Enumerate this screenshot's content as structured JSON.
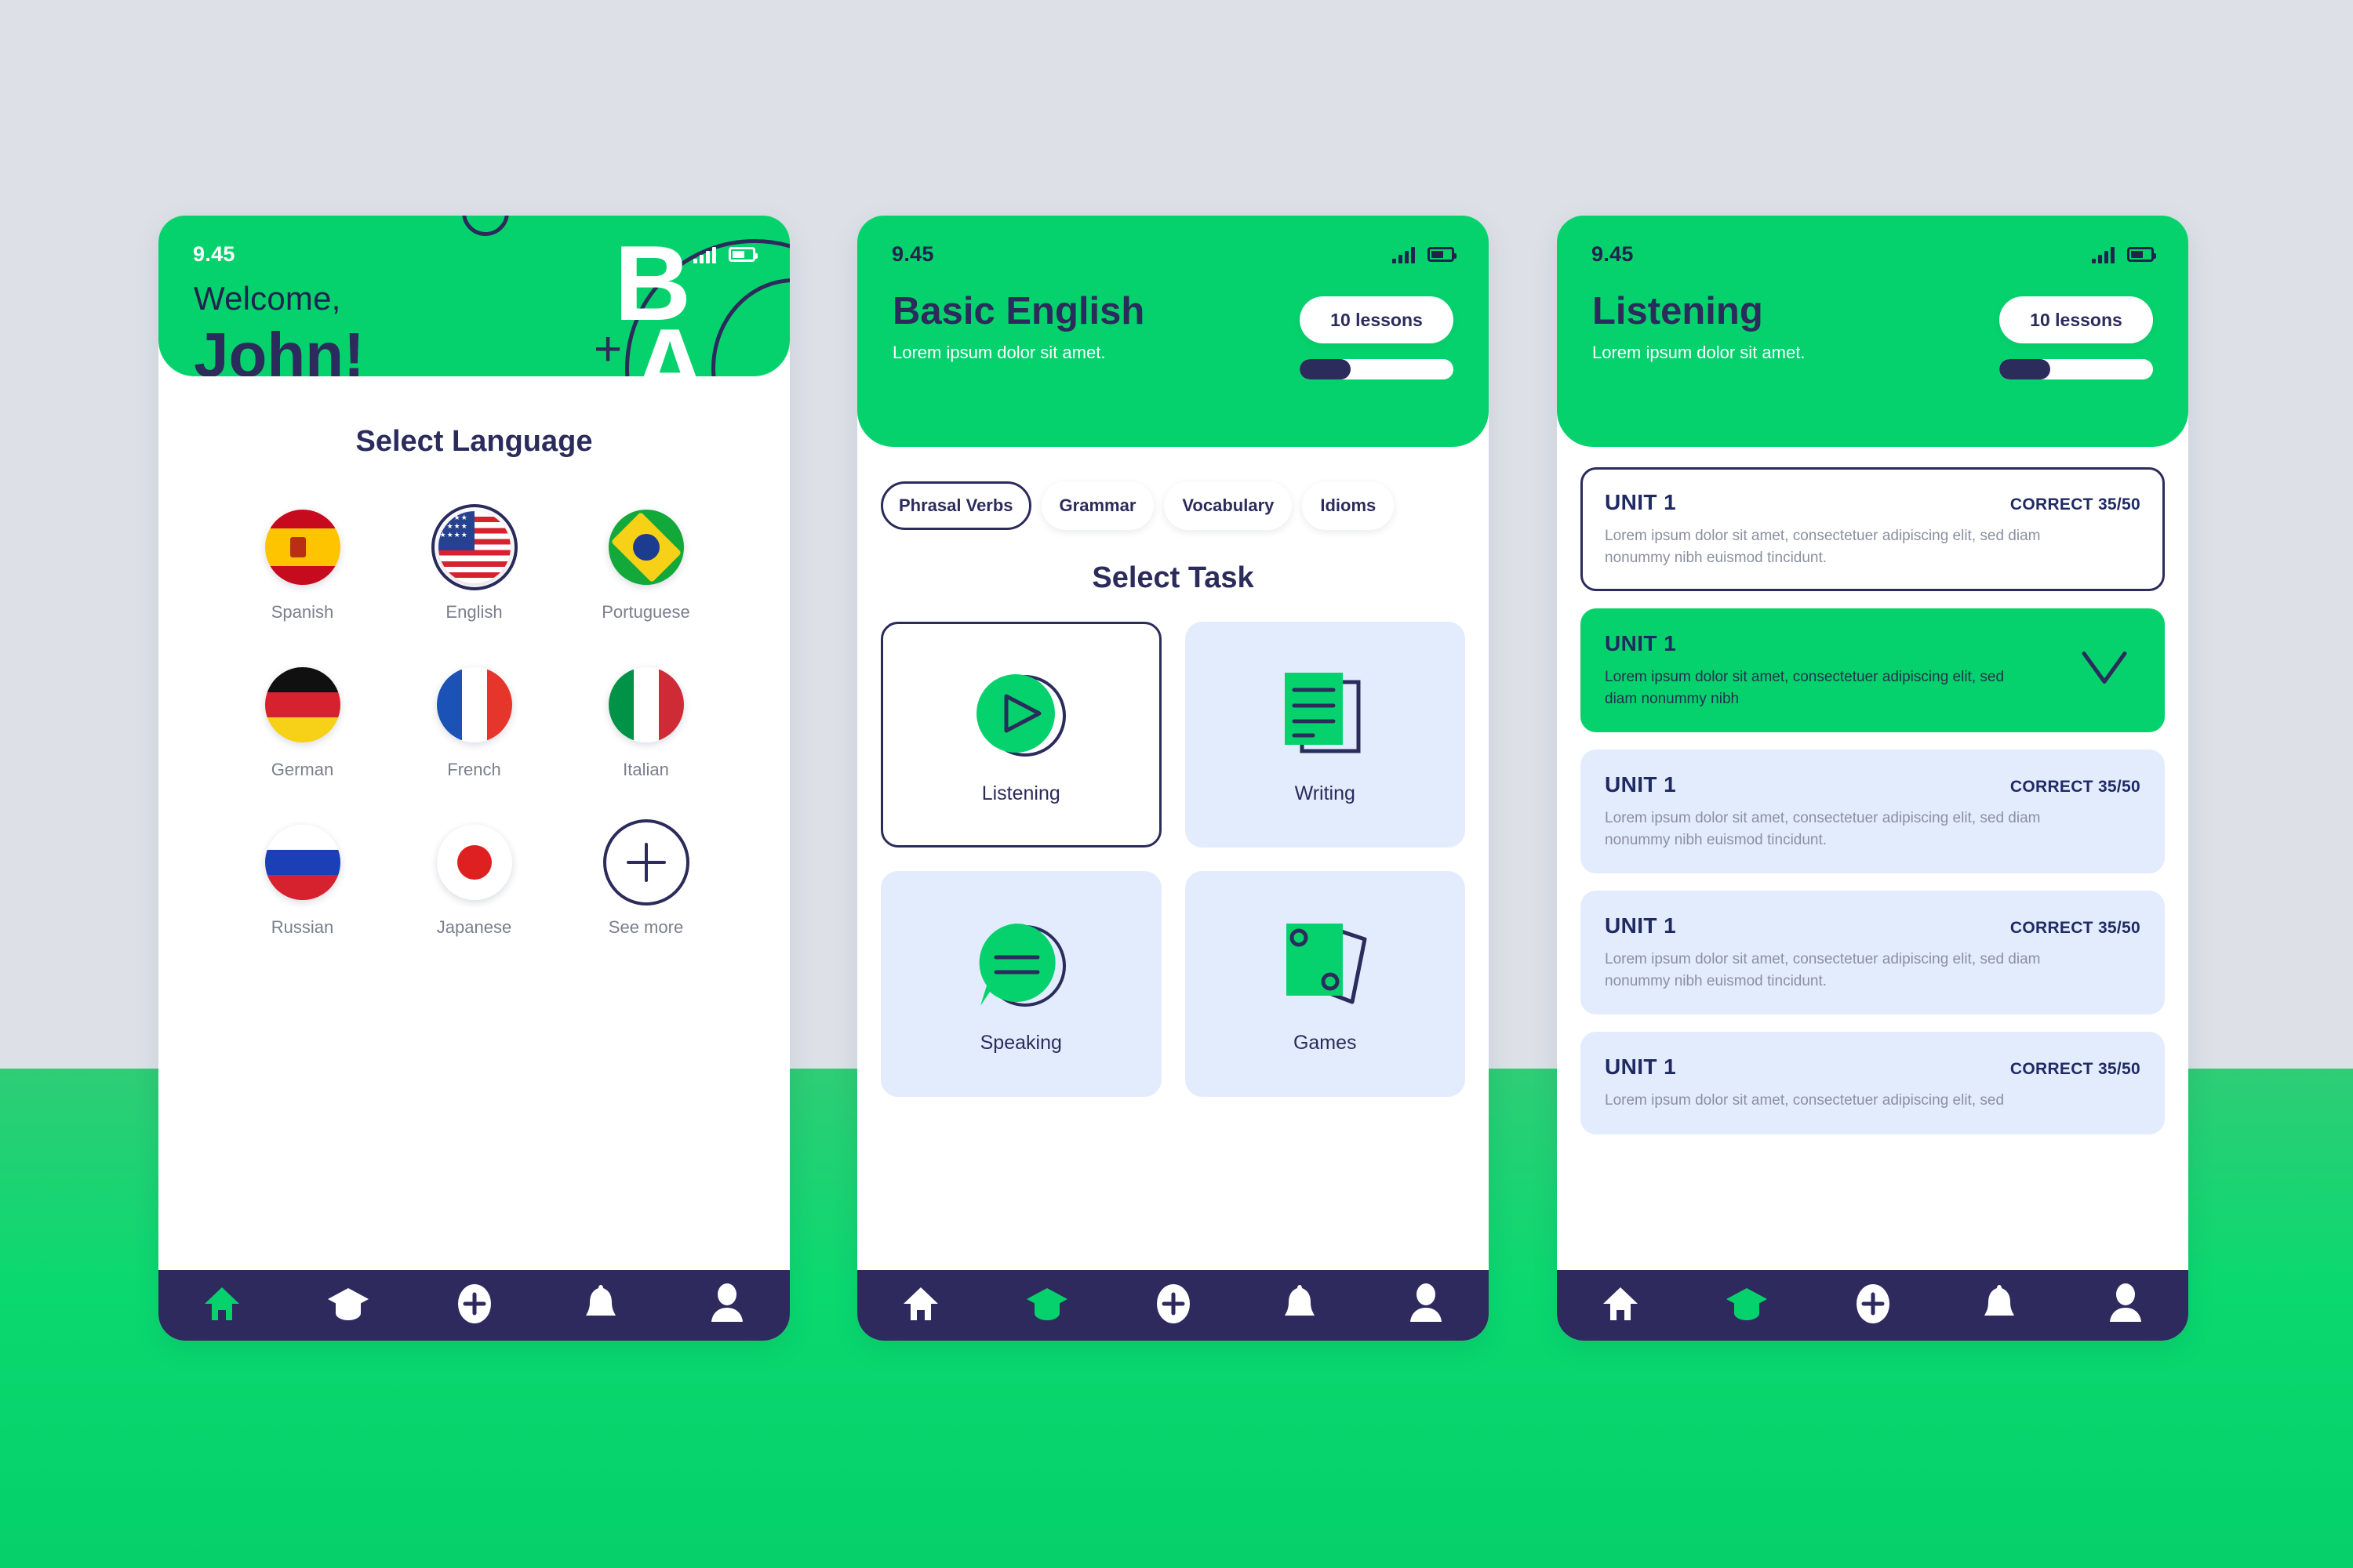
{
  "theme": {
    "green": "#06d26d",
    "navy": "#2b2b5c",
    "light_blue": "#e3ecfd",
    "bg_top": "#dde1e7"
  },
  "screen1": {
    "status": {
      "time": "9.45",
      "signal_icon": "signal-bars-icon",
      "battery_icon": "battery-icon"
    },
    "logo": {
      "letter_b": "B",
      "plus": "+",
      "letter_a": "A"
    },
    "greeting_line1": "Welcome,",
    "greeting_name": "John!",
    "section_title": "Select Language",
    "languages": [
      {
        "label": "Spanish",
        "flag": "flag-spain-icon",
        "selected": false
      },
      {
        "label": "English",
        "flag": "flag-usa-icon",
        "selected": true
      },
      {
        "label": "Portuguese",
        "flag": "flag-brazil-icon",
        "selected": false
      },
      {
        "label": "German",
        "flag": "flag-germany-icon",
        "selected": false
      },
      {
        "label": "French",
        "flag": "flag-france-icon",
        "selected": false
      },
      {
        "label": "Italian",
        "flag": "flag-italy-icon",
        "selected": false
      },
      {
        "label": "Russian",
        "flag": "flag-russia-icon",
        "selected": false
      },
      {
        "label": "Japanese",
        "flag": "flag-japan-icon",
        "selected": false
      },
      {
        "label": "See more",
        "flag": "plus-icon",
        "selected": false
      }
    ],
    "nav": [
      {
        "name": "home",
        "icon": "home-icon",
        "active": true
      },
      {
        "name": "learn",
        "icon": "graduation-cap-icon",
        "active": false
      },
      {
        "name": "add",
        "icon": "plus-circle-icon",
        "active": false
      },
      {
        "name": "notifications",
        "icon": "bell-icon",
        "active": false
      },
      {
        "name": "profile",
        "icon": "user-icon",
        "active": false
      }
    ]
  },
  "screen2": {
    "status": {
      "time": "9.45",
      "signal_icon": "signal-bars-icon",
      "battery_icon": "battery-icon"
    },
    "title": "Basic English",
    "subtitle": "Lorem ipsum dolor sit amet.",
    "lessons_badge": "10 lessons",
    "progress_percent": 33,
    "chips": [
      {
        "label": "Phrasal Verbs",
        "active": true
      },
      {
        "label": "Grammar",
        "active": false
      },
      {
        "label": "Vocabulary",
        "active": false
      },
      {
        "label": "Idioms",
        "active": false
      }
    ],
    "section_title": "Select Task",
    "tasks": [
      {
        "label": "Listening",
        "icon": "play-circle-icon",
        "active": true
      },
      {
        "label": "Writing",
        "icon": "document-icon",
        "active": false
      },
      {
        "label": "Speaking",
        "icon": "speech-bubble-icon",
        "active": false
      },
      {
        "label": "Games",
        "icon": "cards-icon",
        "active": false
      }
    ],
    "nav": [
      {
        "name": "home",
        "icon": "home-icon",
        "active": false
      },
      {
        "name": "learn",
        "icon": "graduation-cap-icon",
        "active": true
      },
      {
        "name": "add",
        "icon": "plus-circle-icon",
        "active": false
      },
      {
        "name": "notifications",
        "icon": "bell-icon",
        "active": false
      },
      {
        "name": "profile",
        "icon": "user-icon",
        "active": false
      }
    ]
  },
  "screen3": {
    "status": {
      "time": "9.45",
      "signal_icon": "signal-bars-icon",
      "battery_icon": "battery-icon"
    },
    "title": "Listening",
    "subtitle": "Lorem ipsum dolor sit amet.",
    "lessons_badge": "10 lessons",
    "progress_percent": 33,
    "units": [
      {
        "name": "UNIT 1",
        "score": "CORRECT 35/50",
        "state": "outline",
        "desc": "Lorem ipsum dolor sit amet, consectetuer adipiscing elit, sed diam nonummy nibh euismod tincidunt."
      },
      {
        "name": "UNIT 1",
        "score": "",
        "state": "done",
        "check_icon": "check-icon",
        "desc": "Lorem ipsum dolor sit amet, consectetuer adipiscing elit, sed diam nonummy nibh"
      },
      {
        "name": "UNIT 1",
        "score": "CORRECT 35/50",
        "state": "filled",
        "desc": "Lorem ipsum dolor sit amet, consectetuer adipiscing elit, sed diam nonummy nibh euismod tincidunt."
      },
      {
        "name": "UNIT 1",
        "score": "CORRECT 35/50",
        "state": "filled",
        "desc": "Lorem ipsum dolor sit amet, consectetuer adipiscing elit, sed diam nonummy nibh euismod tincidunt."
      },
      {
        "name": "UNIT 1",
        "score": "CORRECT 35/50",
        "state": "filled",
        "desc": "Lorem ipsum dolor sit amet, consectetuer adipiscing elit, sed"
      }
    ],
    "nav": [
      {
        "name": "home",
        "icon": "home-icon",
        "active": false
      },
      {
        "name": "learn",
        "icon": "graduation-cap-icon",
        "active": true
      },
      {
        "name": "add",
        "icon": "plus-circle-icon",
        "active": false
      },
      {
        "name": "notifications",
        "icon": "bell-icon",
        "active": false
      },
      {
        "name": "profile",
        "icon": "user-icon",
        "active": false
      }
    ]
  }
}
